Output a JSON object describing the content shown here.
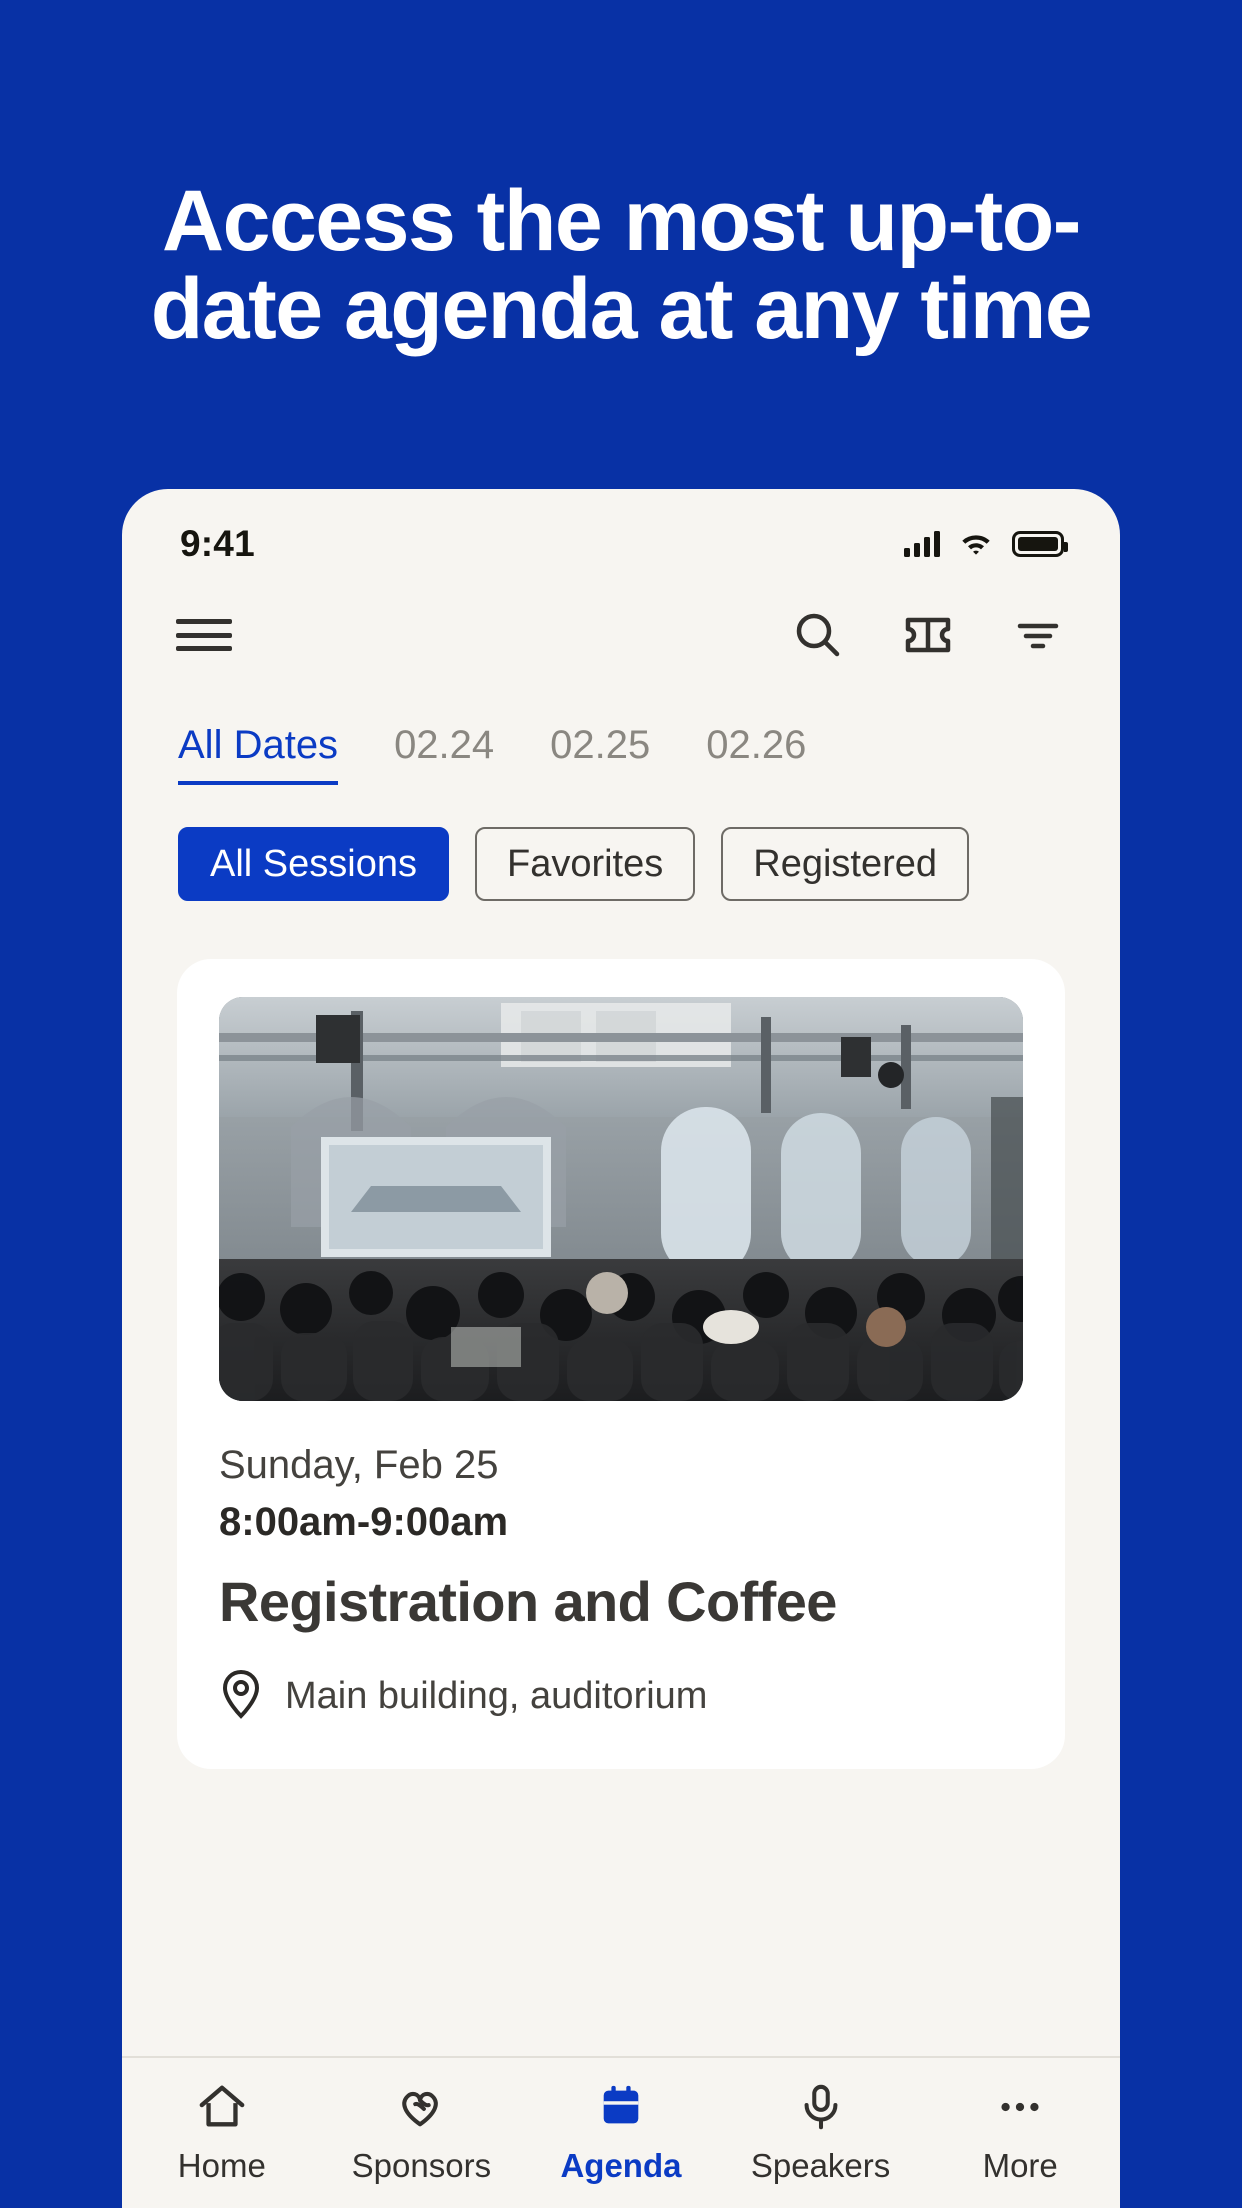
{
  "theme": {
    "brand_blue": "#0831A5",
    "accent_blue": "#0B3BC4",
    "app_background": "#F7F5F1",
    "card_background": "#FFFFFF",
    "text_dark": "#33312E",
    "text_muted": "#8A8781"
  },
  "headline": {
    "line1": "Access the most up-to-",
    "line2": "date agenda at any time"
  },
  "status_bar": {
    "time": "9:41",
    "signal_icon": "cellular-signal-icon",
    "wifi_icon": "wifi-icon",
    "battery_icon": "battery-full-icon"
  },
  "app_header": {
    "menu_icon": "hamburger-menu-icon",
    "search_icon": "search-icon",
    "ticket_icon": "ticket-icon",
    "filter_icon": "filter-icon"
  },
  "date_tabs": [
    {
      "label": "All Dates",
      "active": true
    },
    {
      "label": "02.24",
      "active": false
    },
    {
      "label": "02.25",
      "active": false
    },
    {
      "label": "02.26",
      "active": false
    }
  ],
  "session_filters": [
    {
      "label": "All Sessions",
      "active": true
    },
    {
      "label": "Favorites",
      "active": false
    },
    {
      "label": "Registered",
      "active": false
    }
  ],
  "session_card": {
    "photo_alt": "conference-hall-crowd-photo",
    "date": "Sunday, Feb 25",
    "time": "8:00am-9:00am",
    "title": "Registration and Coffee",
    "location_icon": "location-pin-icon",
    "location": "Main building, auditorium"
  },
  "bottom_nav": [
    {
      "label": "Home",
      "icon": "home-icon",
      "active": false
    },
    {
      "label": "Sponsors",
      "icon": "hearts-icon",
      "active": false
    },
    {
      "label": "Agenda",
      "icon": "calendar-icon",
      "active": true
    },
    {
      "label": "Speakers",
      "icon": "microphone-icon",
      "active": false
    },
    {
      "label": "More",
      "icon": "ellipsis-icon",
      "active": false
    }
  ]
}
